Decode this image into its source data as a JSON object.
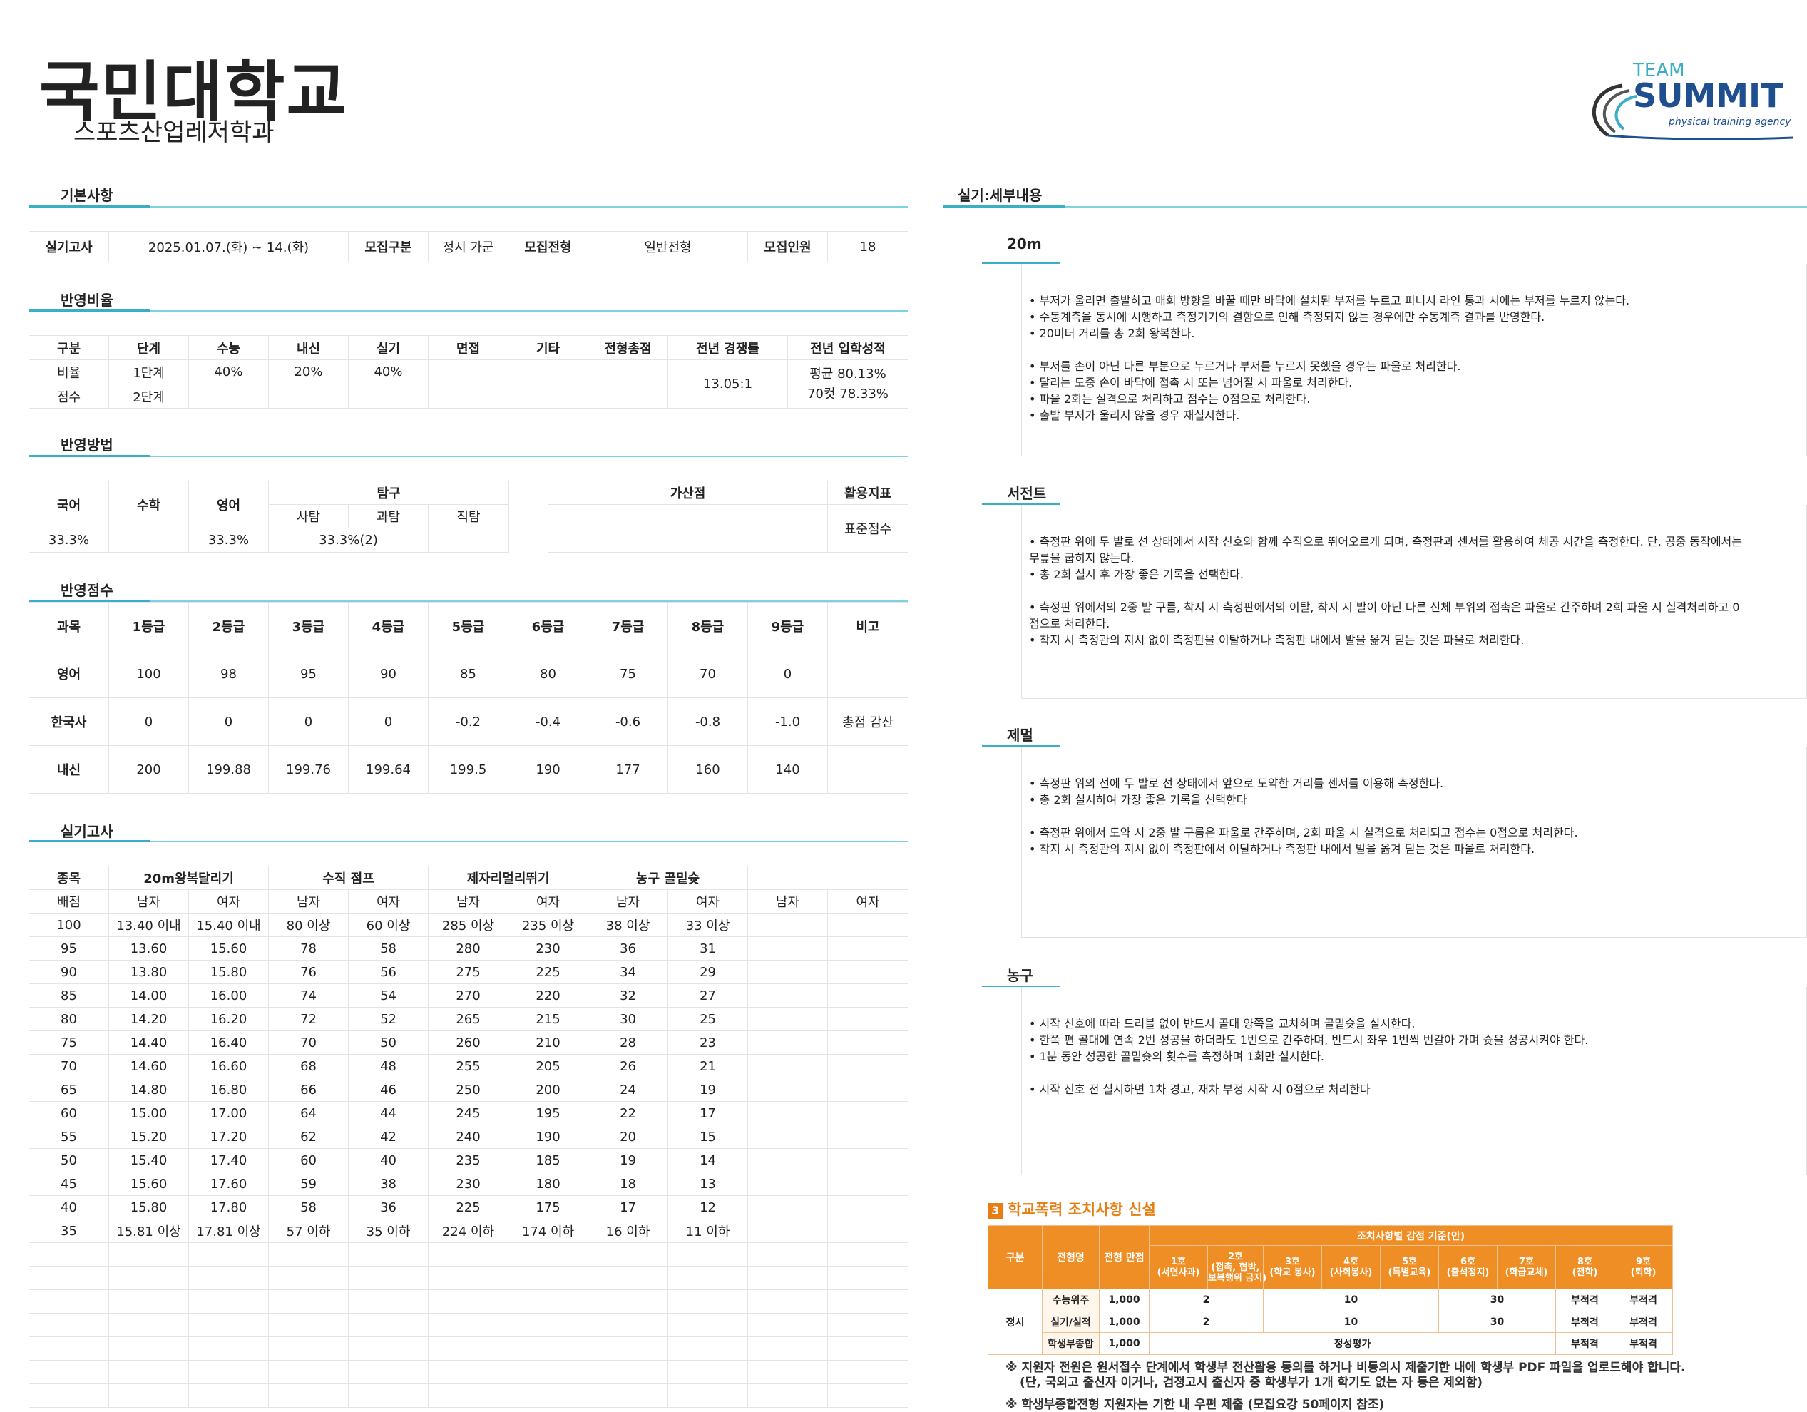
{
  "header": {
    "school": "국민대학교",
    "department": "스포츠산업레저학과"
  },
  "logo": {
    "top": "TEAM",
    "main": "SUMMIT",
    "tagline": "physical training agency",
    "color": "#1f4f8f",
    "accent": "#3aaec4"
  },
  "sections": {
    "basic": "기본사항",
    "ratio": "반영비율",
    "method": "반영방법",
    "score": "반영점수",
    "practical": "실기고사",
    "details": "실기:세부내용"
  },
  "basic": {
    "exam_label": "실기고사",
    "exam_date": "2025.01.07.(화) ~ 14.(화)",
    "group_label": "모집구분",
    "group": "정시 가군",
    "type_label": "모집전형",
    "type": "일반전형",
    "quota_label": "모집인원",
    "quota": "18"
  },
  "ratio": {
    "headers": [
      "구분",
      "단계",
      "수능",
      "내신",
      "실기",
      "면접",
      "기타",
      "전형총점",
      "전년 경쟁률",
      "전년 입학성적"
    ],
    "row1": [
      "비율",
      "1단계",
      "40%",
      "20%",
      "40%",
      "",
      "",
      ""
    ],
    "row2": [
      "점수",
      "2단계",
      "",
      "",
      "",
      "",
      "",
      ""
    ],
    "competition": "13.05:1",
    "avg": "평균 80.13%",
    "cut70": "70컷 78.33%"
  },
  "method": {
    "h": [
      "국어",
      "수학",
      "영어",
      "탐구",
      "사탐",
      "과탐",
      "직탐",
      "가산점",
      "활용지표"
    ],
    "v": [
      "33.3%",
      "",
      "33.3%",
      "33.3%(2)"
    ],
    "index": "표준점수"
  },
  "score": {
    "headers": [
      "과목",
      "1등급",
      "2등급",
      "3등급",
      "4등급",
      "5등급",
      "6등급",
      "7등급",
      "8등급",
      "9등급",
      "비고"
    ],
    "rows": [
      [
        "영어",
        "100",
        "98",
        "95",
        "90",
        "85",
        "80",
        "75",
        "70",
        "0",
        ""
      ],
      [
        "한국사",
        "0",
        "0",
        "0",
        "0",
        "-0.2",
        "-0.4",
        "-0.6",
        "-0.8",
        "-1.0",
        "총점 감산"
      ],
      [
        "내신",
        "200",
        "199.88",
        "199.76",
        "199.64",
        "199.5",
        "190",
        "177",
        "160",
        "140",
        ""
      ]
    ]
  },
  "practical": {
    "h1": [
      "종목",
      "20m왕복달리기",
      "수직 점프",
      "제자리멀리뛰기",
      "농구 골밑슛",
      ""
    ],
    "h2": [
      "배점",
      "남자",
      "여자",
      "남자",
      "여자",
      "남자",
      "여자",
      "남자",
      "여자",
      "남자",
      "여자"
    ],
    "rows": [
      [
        "100",
        "13.40 이내",
        "15.40 이내",
        "80 이상",
        "60 이상",
        "285 이상",
        "235 이상",
        "38 이상",
        "33 이상",
        "",
        ""
      ],
      [
        "95",
        "13.60",
        "15.60",
        "78",
        "58",
        "280",
        "230",
        "36",
        "31",
        "",
        ""
      ],
      [
        "90",
        "13.80",
        "15.80",
        "76",
        "56",
        "275",
        "225",
        "34",
        "29",
        "",
        ""
      ],
      [
        "85",
        "14.00",
        "16.00",
        "74",
        "54",
        "270",
        "220",
        "32",
        "27",
        "",
        ""
      ],
      [
        "80",
        "14.20",
        "16.20",
        "72",
        "52",
        "265",
        "215",
        "30",
        "25",
        "",
        ""
      ],
      [
        "75",
        "14.40",
        "16.40",
        "70",
        "50",
        "260",
        "210",
        "28",
        "23",
        "",
        ""
      ],
      [
        "70",
        "14.60",
        "16.60",
        "68",
        "48",
        "255",
        "205",
        "26",
        "21",
        "",
        ""
      ],
      [
        "65",
        "14.80",
        "16.80",
        "66",
        "46",
        "250",
        "200",
        "24",
        "19",
        "",
        ""
      ],
      [
        "60",
        "15.00",
        "17.00",
        "64",
        "44",
        "245",
        "195",
        "22",
        "17",
        "",
        ""
      ],
      [
        "55",
        "15.20",
        "17.20",
        "62",
        "42",
        "240",
        "190",
        "20",
        "15",
        "",
        ""
      ],
      [
        "50",
        "15.40",
        "17.40",
        "60",
        "40",
        "235",
        "185",
        "19",
        "14",
        "",
        ""
      ],
      [
        "45",
        "15.60",
        "17.60",
        "59",
        "38",
        "230",
        "180",
        "18",
        "13",
        "",
        ""
      ],
      [
        "40",
        "15.80",
        "17.80",
        "58",
        "36",
        "225",
        "175",
        "17",
        "12",
        "",
        ""
      ],
      [
        "35",
        "15.81 이상",
        "17.81 이상",
        "57 이하",
        "35 이하",
        "224 이하",
        "174 이하",
        "16 이하",
        "11 이하",
        "",
        ""
      ],
      [
        "",
        "",
        "",
        "",
        "",
        "",
        "",
        "",
        "",
        "",
        ""
      ],
      [
        "",
        "",
        "",
        "",
        "",
        "",
        "",
        "",
        "",
        "",
        ""
      ],
      [
        "",
        "",
        "",
        "",
        "",
        "",
        "",
        "",
        "",
        "",
        ""
      ],
      [
        "",
        "",
        "",
        "",
        "",
        "",
        "",
        "",
        "",
        "",
        ""
      ],
      [
        "",
        "",
        "",
        "",
        "",
        "",
        "",
        "",
        "",
        "",
        ""
      ],
      [
        "",
        "",
        "",
        "",
        "",
        "",
        "",
        "",
        "",
        "",
        ""
      ],
      [
        "",
        "",
        "",
        "",
        "",
        "",
        "",
        "",
        "",
        "",
        ""
      ]
    ]
  },
  "details": [
    {
      "title": "20m",
      "lines": [
        "• 부저가 울리면 출발하고 매회 방향을 바꿀 때만 바닥에 설치된 부저를 누르고 피니시 라인 통과 시에는 부저를 누르지 않는다.",
        "• 수동계측을 동시에 시행하고 측정기기의 결함으로 인해 측정되지 않는 경우에만 수동계측 결과를 반영한다.",
        "• 20미터 거리를 총 2회 왕복한다.",
        "",
        "• 부저를 손이 아닌 다른 부분으로 누르거나 부저를 누르지 못했을 경우는 파울로 처리한다.",
        "• 달리는 도중 손이 바닥에 접촉 시 또는 넘어질 시 파울로 처리한다.",
        "• 파울 2회는 실격으로 처리하고 점수는 0점으로 처리한다.",
        "• 출발 부저가 울리지 않을 경우 재실시한다."
      ]
    },
    {
      "title": "서전트",
      "lines": [
        "• 측정판 위에 두 발로 선 상태에서 시작 신호와 함께 수직으로 뛰어오르게 되며, 측정판과 센서를 활용하여 체공 시간을 측정한다. 단, 공중 동작에서는",
        "무릎을 굽히지 않는다.",
        "• 총 2회 실시 후 가장 좋은 기록을 선택한다.",
        "",
        "• 측정판 위에서의 2중 발 구름, 착지 시 측정판에서의 이탈, 착지 시 발이 아닌 다른 신체 부위의 접촉은 파울로 간주하며 2회 파울 시 실격처리하고 0",
        "점으로 처리한다.",
        "• 착지 시 측정관의 지시 없이 측정판을 이탈하거나 측정판 내에서 발을 옮겨 딛는 것은 파울로 처리한다."
      ]
    },
    {
      "title": "제멀",
      "lines": [
        "• 측정판 위의 선에 두 발로 선 상태에서 앞으로 도약한 거리를 센서를 이용해 측정한다.",
        "• 총 2회 실시하여 가장 좋은 기록을 선택한다",
        "",
        "• 측정판 위에서 도약 시 2중 발 구름은 파울로 간주하며, 2회 파울 시 실격으로 처리되고 점수는 0점으로 처리한다.",
        "• 착지 시 측정관의 지시 없이 측정판에서 이탈하거나 측정판 내에서 발을 옮겨 딛는 것은 파울로 처리한다."
      ]
    },
    {
      "title": "농구",
      "lines": [
        "• 시작 신호에 따라 드리블 없이 반드시 골대 양쪽을 교차하며 골밑슛을 실시한다.",
        "• 한쪽 편 골대에 연속 2번 성공을 하더라도 1번으로 간주하며, 반드시 좌우 1번씩 번갈아 가며 슛을 성공시켜야 한다.",
        "• 1분 동안 성공한 골밑슛의 횟수를 측정하며 1회만 실시한다.",
        "",
        "• 시작 신호 전 실시하면 1차 경고, 재차 부정 시작 시 0점으로 처리한다"
      ]
    }
  ],
  "violence": {
    "num": "3",
    "title": "학교폭력 조치사항 신설",
    "h_gubun": "구분",
    "h_type": "전형명",
    "h_full": "전형 만점",
    "h_criteria": "조치사항별 감점 기준(안)",
    "cols": [
      {
        "a": "1호",
        "b": "(서면사과)"
      },
      {
        "a": "2호",
        "b": "(접촉, 협박,",
        "c": "보복행위 금지)"
      },
      {
        "a": "3호",
        "b": "(학교 봉사)"
      },
      {
        "a": "4호",
        "b": "(사회봉사)"
      },
      {
        "a": "5호",
        "b": "(특별교육)"
      },
      {
        "a": "6호",
        "b": "(출석정지)"
      },
      {
        "a": "7호",
        "b": "(학급교체)"
      },
      {
        "a": "8호",
        "b": "(전학)"
      },
      {
        "a": "9호",
        "b": "(퇴학)"
      }
    ],
    "group": "정시",
    "rows": [
      {
        "name": "수능위주",
        "full": "1,000",
        "v12": "2",
        "v345": "10",
        "v67": "30",
        "v8": "부적격",
        "v9": "부적격"
      },
      {
        "name": "실기/실적",
        "full": "1,000",
        "v12": "2",
        "v345": "10",
        "v67": "30",
        "v8": "부적격",
        "v9": "부적격"
      },
      {
        "name": "학생부종합",
        "full": "1,000",
        "eval": "정성평가",
        "v8": "부적격",
        "v9": "부적격"
      }
    ],
    "note1": "※ 지원자 전원은 원서접수 단계에서 학생부 전산활용 동의를 하거나 비동의시 제출기한 내에 학생부 PDF 파일을 업로드해야 합니다.",
    "note2": "(단, 국외고 출신자 이거나, 검정고시 출신자 중 학생부가 1개 학기도 없는 자 등은 제외함)",
    "note3": "※ 학생부종합전형 지원자는 기한 내 우편 제출 (모집요강 50페이지 참조)"
  }
}
